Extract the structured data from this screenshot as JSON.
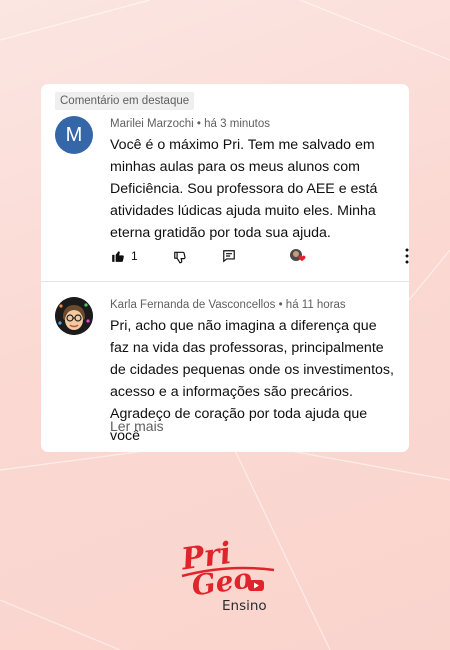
{
  "featured_badge": "Comentário em destaque",
  "comments": [
    {
      "avatar_letter": "M",
      "author": "Marilei Marzochi",
      "time": "há 3 minutos",
      "text": "Você é o máximo Pri. Tem me salvado em\nminhas aulas para os meus alunos com\nDeficiência. Sou professora do AEE e está\natividades lúdicas ajuda muito eles. Minha\neterna gratidão por toda sua ajuda.",
      "likes": "1"
    },
    {
      "author": "Karla Fernanda de Vasconcellos",
      "time": "há 11 horas",
      "text": "Pri, acho que não imagina a diferença que\nfaz na vida das professoras, principalmente\nde cidades pequenas onde os investimentos,\nacesso e a informações são precários.\nAgradeço de coração por toda ajuda que você",
      "read_more": "Ler mais"
    }
  ],
  "meta_separator": "•",
  "brand": {
    "line1": "Pri",
    "line2": "Geo",
    "line3": "Ensino",
    "color": "#e0242b"
  },
  "colors": {
    "accent_avatar": "#3566a8",
    "heart": "#e0242b"
  },
  "icons": [
    "thumbs-up-icon",
    "thumbs-down-icon",
    "reply-icon",
    "creator-heart-icon",
    "more-icon"
  ]
}
